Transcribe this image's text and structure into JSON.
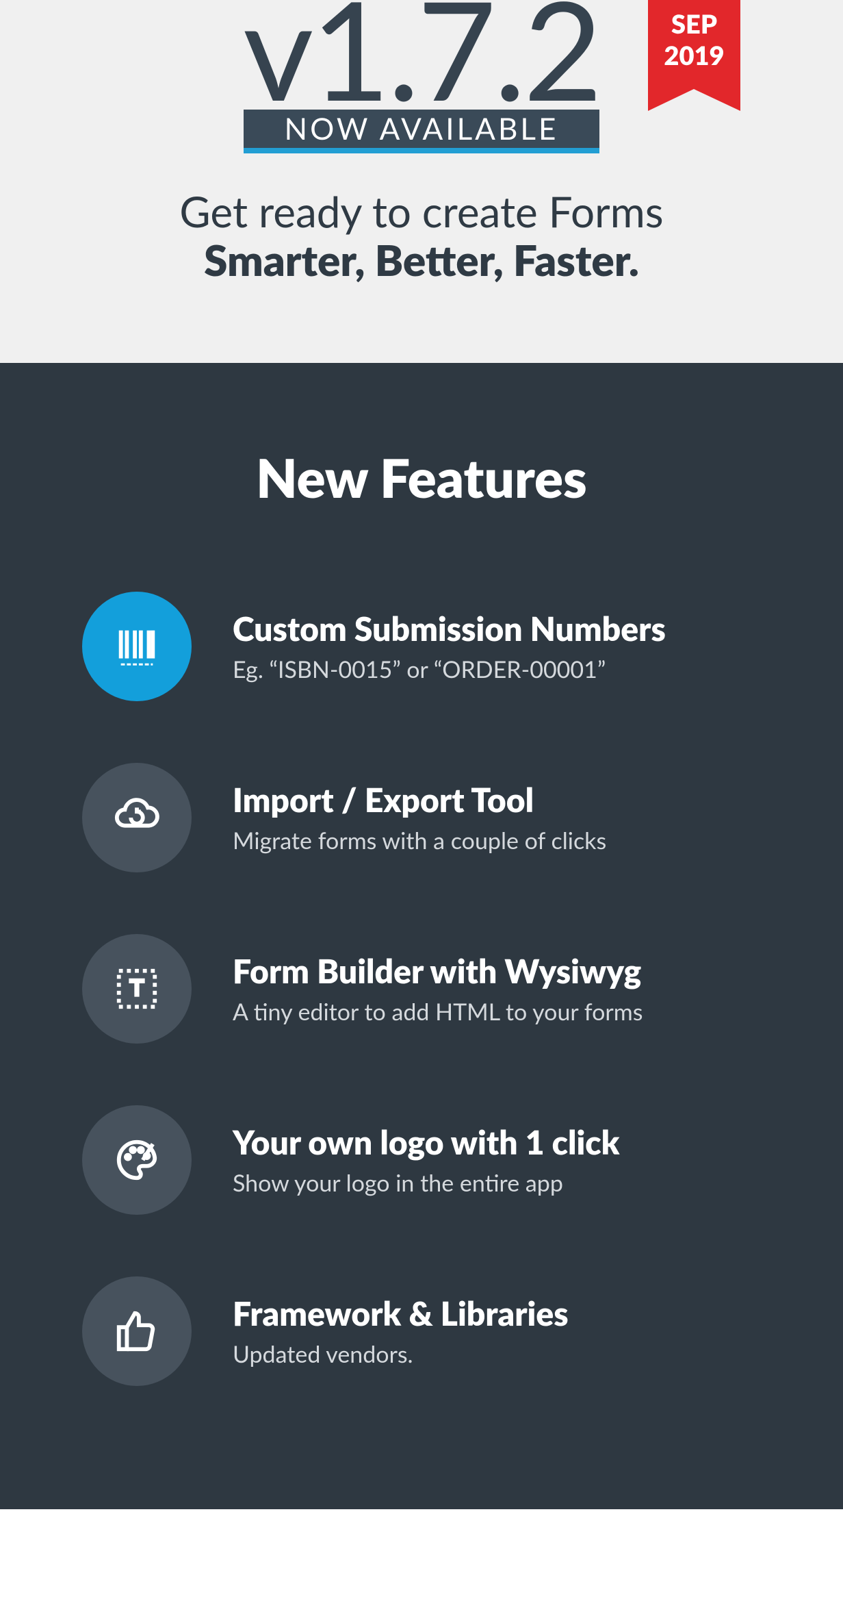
{
  "hero": {
    "version": "v1.7.2",
    "badge": "NOW AVAILABLE",
    "ribbon_month": "SEP",
    "ribbon_year": "2019",
    "tagline_line1": "Get ready to create Forms",
    "tagline_line2": "Smarter, Better, Faster."
  },
  "section_title": "New Features",
  "features": [
    {
      "icon": "barcode-icon",
      "accent": true,
      "title": "Custom Submission Numbers",
      "desc": "Eg. “ISBN-0015” or “ORDER-00001”"
    },
    {
      "icon": "cloud-sync-icon",
      "accent": false,
      "title": "Import / Export Tool",
      "desc": "Migrate forms with a couple of clicks"
    },
    {
      "icon": "text-box-icon",
      "accent": false,
      "title": "Form Builder with Wysiwyg",
      "desc": "A tiny editor to add HTML to your forms"
    },
    {
      "icon": "palette-icon",
      "accent": false,
      "title": "Your own logo with 1 click",
      "desc": "Show your logo in the entire app"
    },
    {
      "icon": "thumbs-up-icon",
      "accent": false,
      "title": "Framework & Libraries",
      "desc": "Updated vendors."
    }
  ]
}
